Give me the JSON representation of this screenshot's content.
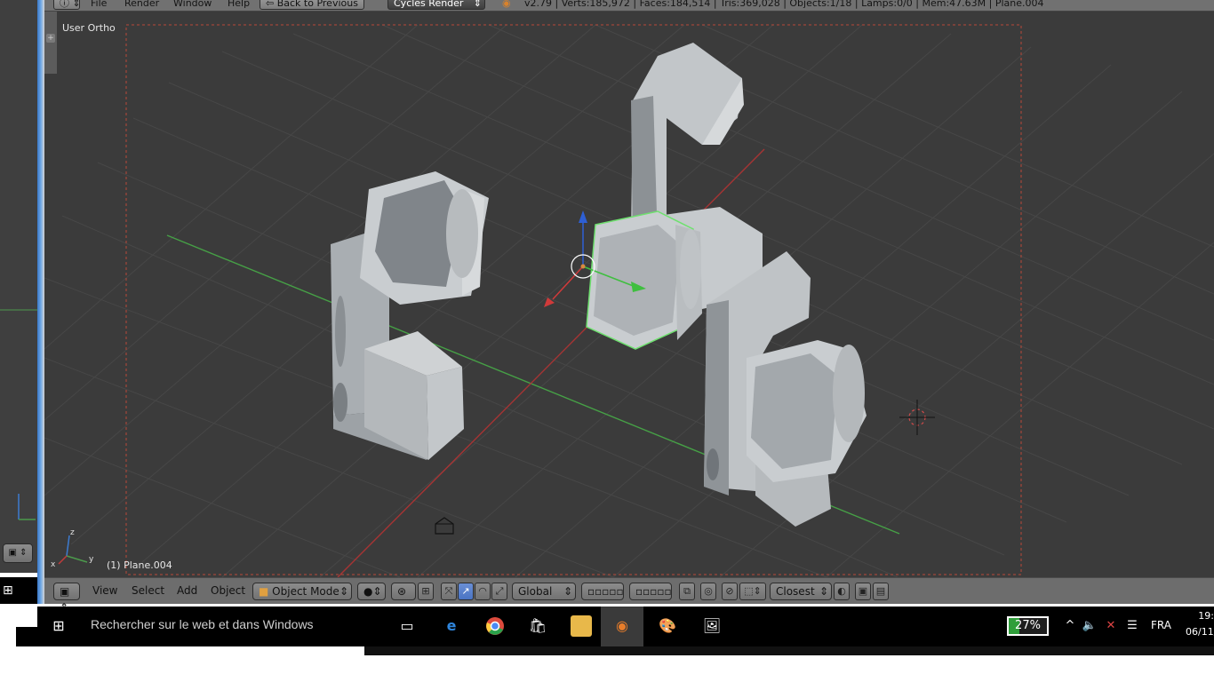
{
  "topbar": {
    "info_icon": "info-icon",
    "menu_file": "File",
    "menu_render": "Render",
    "menu_window": "Window",
    "menu_help": "Help",
    "back_button": "Back to Previous",
    "engine": "Cycles Render",
    "stats": "v2.79 | Verts:185,972 | Faces:184,514 | Tris:369,028 | Objects:1/18 | Lamps:0/0 | Mem:47.63M | Plane.004"
  },
  "viewport": {
    "view_label": "User Ortho",
    "object_label": "(1) Plane.004",
    "axis_x": "x",
    "axis_y": "y",
    "axis_z": "z"
  },
  "header": {
    "menu_view": "View",
    "menu_select": "Select",
    "menu_add": "Add",
    "menu_object": "Object",
    "mode": "Object Mode",
    "orientation": "Global",
    "snap_target": "Closest"
  },
  "taskbar": {
    "search_placeholder": "Rechercher sur le web et dans Windows",
    "battery": "27%",
    "battery_level": 0.27,
    "language": "FRA",
    "time": "19:",
    "date": "06/11/"
  },
  "colors": {
    "viewport_bg": "#3b3b3b",
    "grid": "#474747",
    "x_axis": "#a63434",
    "y_axis": "#46a046",
    "selection_outline": "#6fe06f",
    "model": "#b7bcc0",
    "camera_border": "#b84a3a"
  }
}
